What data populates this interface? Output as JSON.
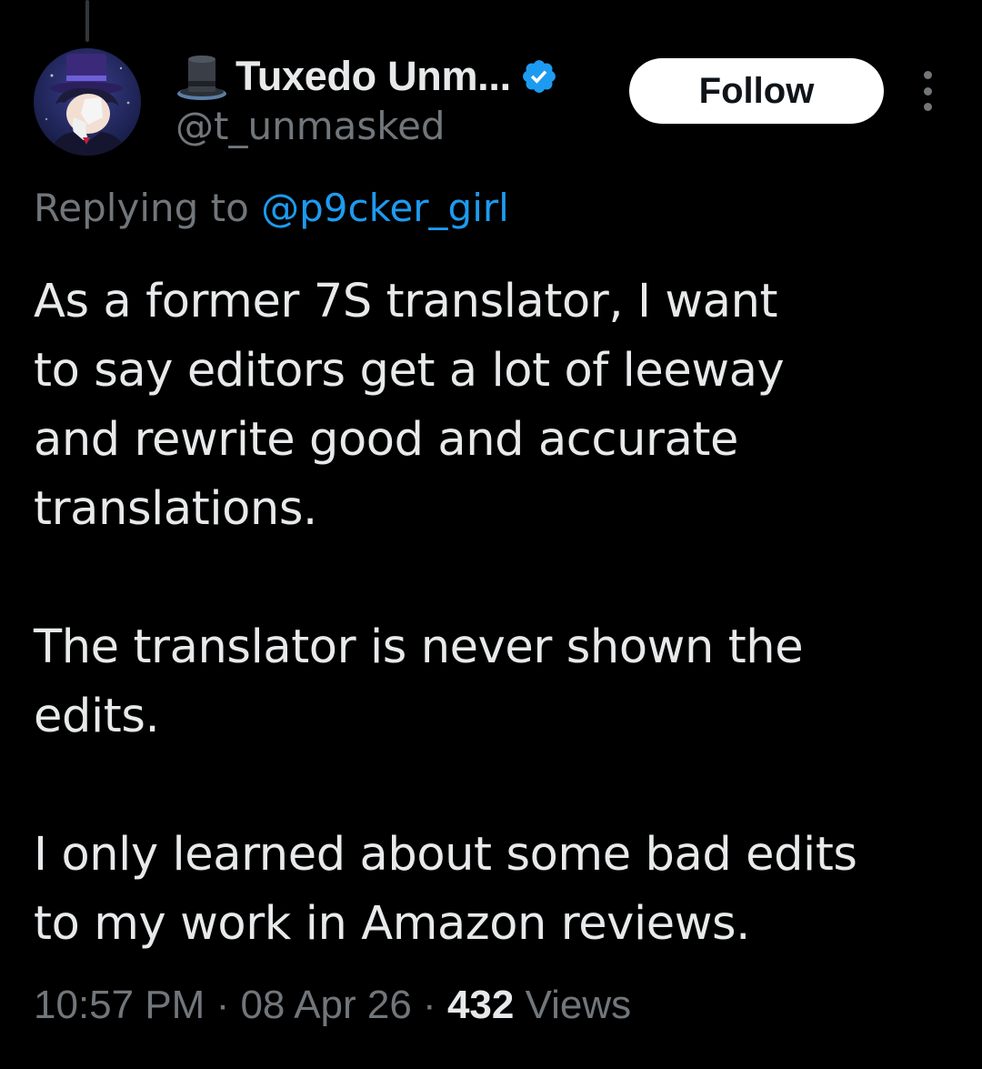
{
  "author": {
    "display_name": "Tuxedo Unm...",
    "handle": "@t_unmasked",
    "emoji_icon": "top-hat-icon",
    "verified_icon": "verified-badge-icon",
    "verified_color": "#1d9bf0"
  },
  "actions": {
    "follow_label": "Follow",
    "more_icon": "more-vertical-icon"
  },
  "reply": {
    "prefix": "Replying to ",
    "mention": "@p9cker_girl"
  },
  "tweet": {
    "lines": [
      [
        "As a former 7S translator, I want",
        "to say editors get a lot of leeway",
        "and rewrite good and accurate",
        "translations."
      ],
      [
        "The translator is never shown the",
        "edits."
      ],
      [
        "I only learned about some bad edits",
        "to my work in Amazon reviews."
      ]
    ]
  },
  "meta": {
    "time": "10:57 PM",
    "separator": " · ",
    "date": "08 Apr 26",
    "views_count": "432",
    "views_label": " Views"
  },
  "colors": {
    "background": "#000000",
    "text": "#e7e9ea",
    "secondary": "#71767b",
    "accent": "#1d9bf0"
  }
}
